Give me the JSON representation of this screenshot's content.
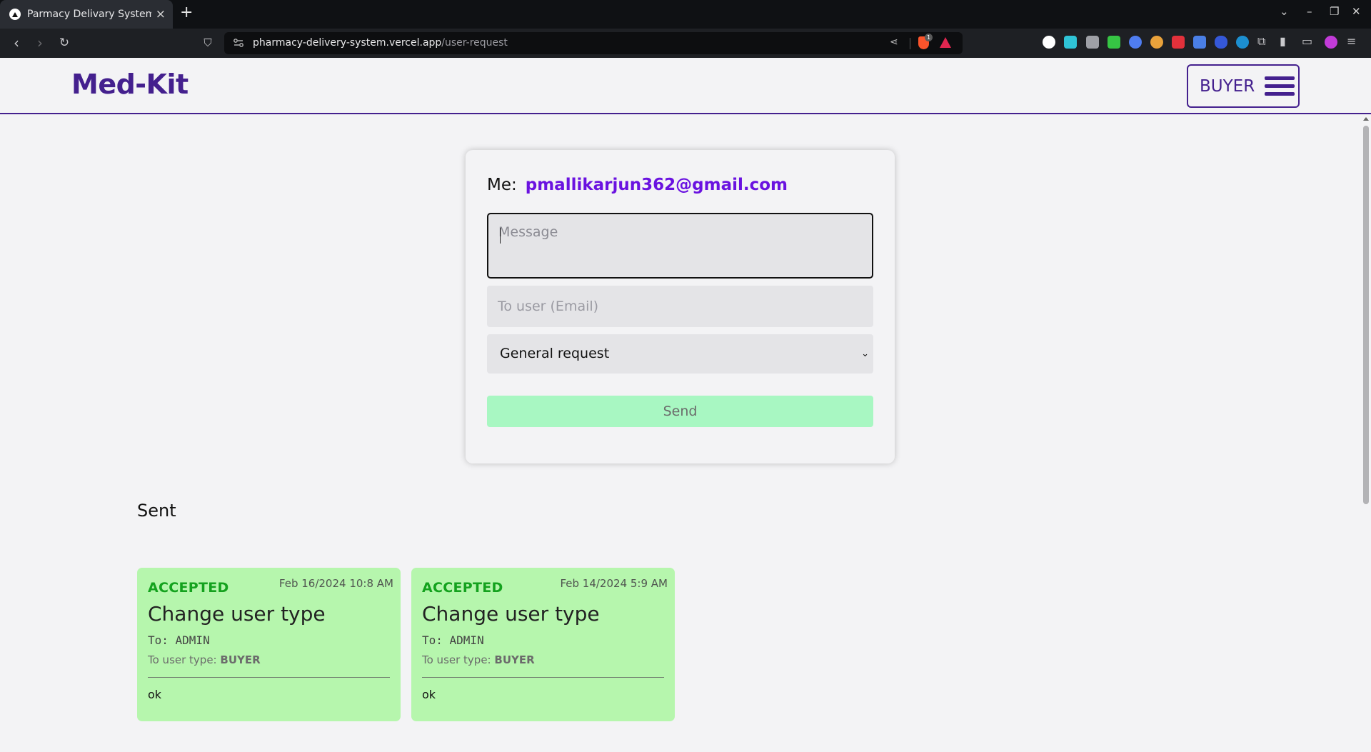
{
  "browser": {
    "tab_title": "Parmacy Delivary System",
    "url_host": "pharmacy-delivery-system.vercel.app",
    "url_path": "/user-request",
    "shield_count": "1"
  },
  "header": {
    "brand": "Med-Kit",
    "role_label": "BUYER"
  },
  "form": {
    "me_label": "Me:",
    "me_email": "pmallikarjun362@gmail.com",
    "message_placeholder": "Message",
    "to_user_placeholder": "To user (Email)",
    "request_type": "General request",
    "send_label": "Send"
  },
  "sent": {
    "heading": "Sent",
    "cards": [
      {
        "status": "ACCEPTED",
        "date": "Feb 16/2024 10:8 AM",
        "title": "Change user type",
        "to": "To: ADMIN",
        "type_label": "To user type:",
        "type_value": "BUYER",
        "message": "ok"
      },
      {
        "status": "ACCEPTED",
        "date": "Feb 14/2024 5:9 AM",
        "title": "Change user type",
        "to": "To: ADMIN",
        "type_label": "To user type:",
        "type_value": "BUYER",
        "message": "ok"
      }
    ]
  },
  "colors": {
    "brand": "#44208e",
    "email": "#6a12e0",
    "accepted": "#14a21e",
    "card_bg": "#b6f6ad",
    "send_bg": "#a8f7c2"
  }
}
